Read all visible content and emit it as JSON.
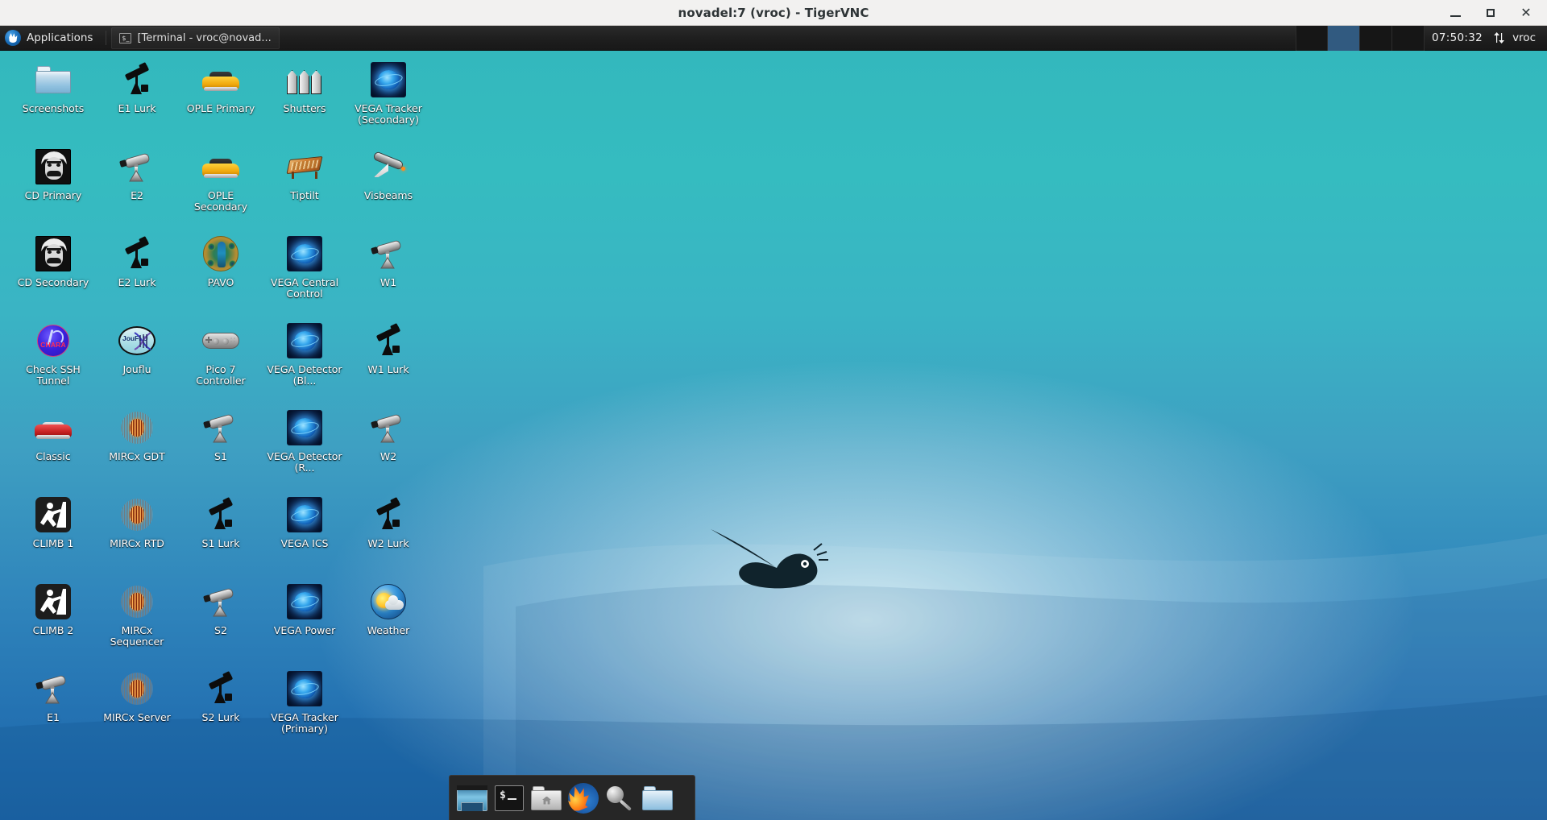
{
  "window": {
    "title": "novadel:7 (vroc) - TigerVNC",
    "minimize_label": "–",
    "maximize_label": "□",
    "close_label": "✕"
  },
  "panel": {
    "applications_label": "Applications",
    "tasks": [
      {
        "label": "[Terminal - vroc@novad...",
        "icon": "terminal-icon",
        "glyph": "$_"
      }
    ],
    "workspaces": [
      {
        "name": "workspace-1",
        "active": false
      },
      {
        "name": "workspace-2",
        "active": true
      },
      {
        "name": "workspace-3",
        "active": false
      },
      {
        "name": "workspace-4",
        "active": false
      }
    ],
    "clock": "07:50:32",
    "network_monitor_icon": "network-up-down-icon",
    "user": "vroc"
  },
  "desktop": {
    "icons": [
      {
        "label": "Screenshots",
        "icon": "folder-icon",
        "art": "folder"
      },
      {
        "label": "E1 Lurk",
        "icon": "telescope-black-icon",
        "art": "telescope-black"
      },
      {
        "label": "OPLE Primary",
        "icon": "yellow-car-icon",
        "art": "car-yellow"
      },
      {
        "label": "Shutters",
        "icon": "shutters-icon",
        "art": "shutters"
      },
      {
        "label": "VEGA Tracker (Secondary)",
        "icon": "vega-globe-icon",
        "art": "vega"
      },
      {
        "label": "CD Primary",
        "icon": "face-portrait-icon",
        "art": "face"
      },
      {
        "label": "E2",
        "icon": "telescope-silver-icon",
        "art": "telescope-silver"
      },
      {
        "label": "OPLE Secondary",
        "icon": "yellow-car-icon",
        "art": "car-yellow"
      },
      {
        "label": "Tiptilt",
        "icon": "tiptilt-stage-icon",
        "art": "tiptilt"
      },
      {
        "label": "Visbeams",
        "icon": "visbeam-icon",
        "art": "visbeam"
      },
      {
        "label": "CD Secondary",
        "icon": "face-portrait-icon",
        "art": "face"
      },
      {
        "label": "E2 Lurk",
        "icon": "telescope-black-icon",
        "art": "telescope-black"
      },
      {
        "label": "PAVO",
        "icon": "peacock-icon",
        "art": "peacock"
      },
      {
        "label": "VEGA Central Control",
        "icon": "vega-globe-icon",
        "art": "vega"
      },
      {
        "label": "W1",
        "icon": "telescope-silver-icon",
        "art": "telescope-silver"
      },
      {
        "label": "Check SSH Tunnel",
        "icon": "chara-logo-icon",
        "art": "chara"
      },
      {
        "label": "Jouflu",
        "icon": "jouflu-logo-icon",
        "art": "jouflu"
      },
      {
        "label": "Pico 7 Controller",
        "icon": "gamepad-icon",
        "art": "gamepad"
      },
      {
        "label": "VEGA Detector (Bl...",
        "icon": "vega-globe-icon",
        "art": "vega"
      },
      {
        "label": "W1 Lurk",
        "icon": "telescope-black-icon",
        "art": "telescope-black"
      },
      {
        "label": "Classic",
        "icon": "red-car-icon",
        "art": "car-red"
      },
      {
        "label": "MIRCx GDT",
        "icon": "fringe-pattern-icon",
        "art": "mircx"
      },
      {
        "label": "S1",
        "icon": "telescope-silver-icon",
        "art": "telescope-silver"
      },
      {
        "label": "VEGA Detector (R...",
        "icon": "vega-globe-icon",
        "art": "vega"
      },
      {
        "label": "W2",
        "icon": "telescope-silver-icon",
        "art": "telescope-silver"
      },
      {
        "label": "CLIMB 1",
        "icon": "climber-icon",
        "art": "climb"
      },
      {
        "label": "MIRCx RTD",
        "icon": "fringe-pattern-icon",
        "art": "mircx"
      },
      {
        "label": "S1 Lurk",
        "icon": "telescope-black-icon",
        "art": "telescope-black"
      },
      {
        "label": "VEGA ICS",
        "icon": "vega-globe-icon",
        "art": "vega"
      },
      {
        "label": "W2 Lurk",
        "icon": "telescope-black-icon",
        "art": "telescope-black"
      },
      {
        "label": "CLIMB 2",
        "icon": "climber-icon",
        "art": "climb"
      },
      {
        "label": "MIRCx Sequencer",
        "icon": "fringe-pattern-icon",
        "art": "mircx"
      },
      {
        "label": "S2",
        "icon": "telescope-silver-icon",
        "art": "telescope-silver"
      },
      {
        "label": "VEGA Power",
        "icon": "vega-globe-icon",
        "art": "vega"
      },
      {
        "label": "Weather",
        "icon": "weather-orb-icon",
        "art": "weather"
      },
      {
        "label": "E1",
        "icon": "telescope-silver-icon",
        "art": "telescope-silver"
      },
      {
        "label": "MIRCx Server",
        "icon": "fringe-pattern-icon",
        "art": "mircx"
      },
      {
        "label": "S2 Lurk",
        "icon": "telescope-black-icon",
        "art": "telescope-black"
      },
      {
        "label": "VEGA Tracker (Primary)",
        "icon": "vega-globe-icon",
        "art": "vega"
      }
    ]
  },
  "dock": {
    "items": [
      {
        "name": "show-desktop-button",
        "label": "Show Desktop",
        "art": "showdesk"
      },
      {
        "name": "terminal-launcher",
        "label": "Terminal",
        "art": "term"
      },
      {
        "name": "home-folder-launcher",
        "label": "Home",
        "art": "home"
      },
      {
        "name": "firefox-launcher",
        "label": "Firefox",
        "art": "fox"
      },
      {
        "name": "search-launcher",
        "label": "Find",
        "art": "search"
      },
      {
        "name": "file-manager-launcher",
        "label": "File Manager",
        "art": "folder"
      }
    ]
  },
  "colors": {
    "panel_bg": "#1f1f1f",
    "workspace_active": "#315a80",
    "desktop_top": "#33b8bd",
    "desktop_bottom": "#1d66a8",
    "titlebar_bg": "#f2f1f0",
    "dock_bg": "#262626"
  }
}
